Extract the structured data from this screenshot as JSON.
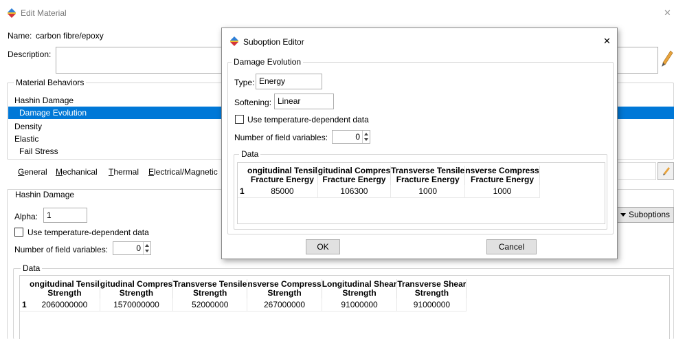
{
  "main_window": {
    "title": "Edit Material",
    "close_glyph": "✕",
    "name_label": "Name:",
    "name_value": "carbon fibre/epoxy",
    "description_label": "Description:",
    "behaviors_group_label": "Material Behaviors",
    "behaviors": [
      {
        "label": "Hashin Damage",
        "indent": false,
        "selected": false
      },
      {
        "label": "Damage Evolution",
        "indent": true,
        "selected": true
      },
      {
        "label": "Density",
        "indent": false,
        "selected": false
      },
      {
        "label": "Elastic",
        "indent": false,
        "selected": false
      },
      {
        "label": "Fail Stress",
        "indent": true,
        "selected": false
      }
    ],
    "menu_tabs": [
      {
        "first": "G",
        "rest": "eneral"
      },
      {
        "first": "M",
        "rest": "echanical"
      },
      {
        "first": "T",
        "rest": "hermal"
      },
      {
        "first": "E",
        "rest": "lectrical/Magnetic"
      }
    ],
    "section_title": "Hashin Damage",
    "alpha_label": "Alpha:",
    "alpha_value": "1",
    "temp_dependent_label": "Use temperature-dependent data",
    "field_vars_label": "Number of field variables:",
    "field_vars_value": "0",
    "suboptions_label": "Suboptions",
    "data_group_label": "Data",
    "table": {
      "headers": [
        [
          "ongitudinal Tensil",
          "Strength"
        ],
        [
          "gitudinal Compres",
          "Strength"
        ],
        [
          "Transverse Tensile",
          "Strength"
        ],
        [
          "nsverse Compress",
          "Strength"
        ],
        [
          "Longitudinal Shear",
          "Strength"
        ],
        [
          "Transverse Shear",
          "Strength"
        ]
      ],
      "rows": [
        {
          "num": "1",
          "cells": [
            "2060000000",
            "1570000000",
            "52000000",
            "267000000",
            "91000000",
            "91000000"
          ]
        }
      ]
    }
  },
  "dialog": {
    "title": "Suboption Editor",
    "close_glyph": "✕",
    "group_label": "Damage Evolution",
    "type_label": "Type:",
    "type_value": "Energy",
    "softening_label": "Softening:",
    "softening_value": "Linear",
    "temp_dependent_label": "Use temperature-dependent data",
    "field_vars_label": "Number of field variables:",
    "field_vars_value": "0",
    "data_group_label": "Data",
    "table": {
      "headers": [
        [
          "ongitudinal Tensil",
          "Fracture Energy"
        ],
        [
          "gitudinal Compres",
          "Fracture Energy"
        ],
        [
          "Transverse Tensile",
          "Fracture Energy"
        ],
        [
          "nsverse Compress",
          "Fracture Energy"
        ]
      ],
      "rows": [
        {
          "num": "1",
          "cells": [
            "85000",
            "106300",
            "1000",
            "1000"
          ]
        }
      ]
    },
    "ok_label": "OK",
    "cancel_label": "Cancel"
  },
  "colors": {
    "selection": "#0078d7",
    "border": "#adadad",
    "button_bg": "#e1e1e1",
    "dialog_border": "#8a8a8a"
  }
}
